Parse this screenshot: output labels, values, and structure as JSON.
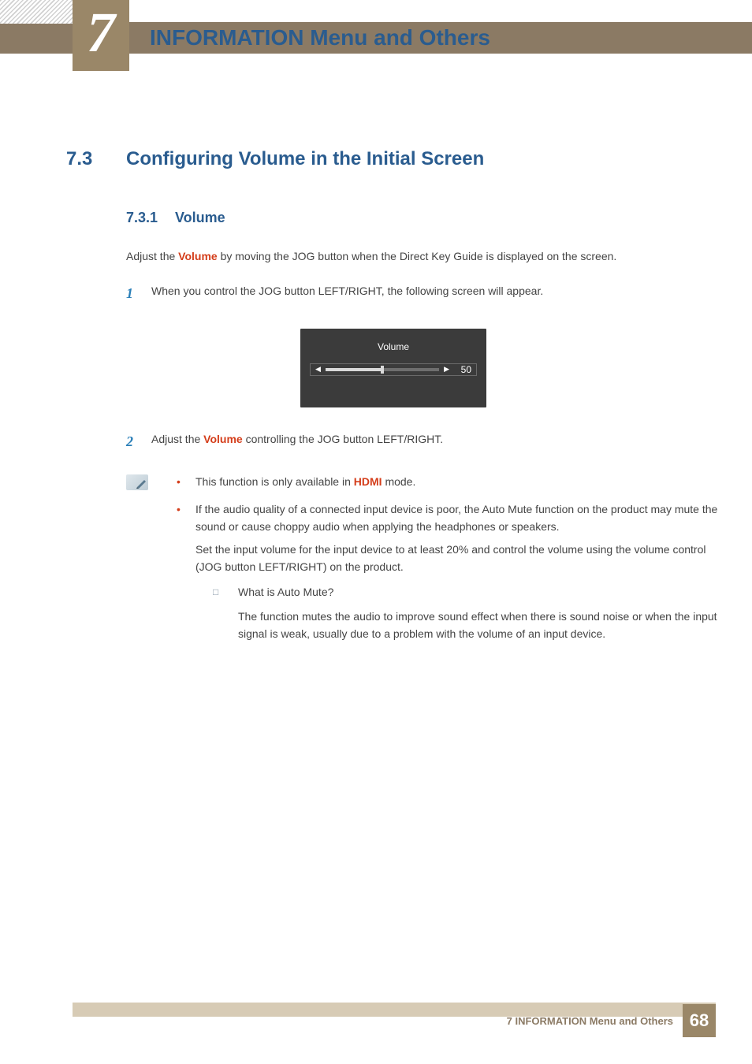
{
  "chapter": {
    "number": "7",
    "title": "INFORMATION Menu and Others"
  },
  "section": {
    "number": "7.3",
    "title": "Configuring Volume in the Initial Screen"
  },
  "subsection": {
    "number": "7.3.1",
    "title": "Volume"
  },
  "intro": {
    "prefix": "Adjust the ",
    "keyword": "Volume",
    "suffix": " by moving the JOG button when the Direct Key Guide is displayed on the screen."
  },
  "steps": [
    {
      "num": "1",
      "text": "When you control the JOG button LEFT/RIGHT, the following screen will appear."
    },
    {
      "num": "2",
      "prefix": "Adjust the ",
      "keyword": "Volume",
      "suffix": " controlling the JOG button LEFT/RIGHT."
    }
  ],
  "osd": {
    "title": "Volume",
    "value": "50"
  },
  "notes": [
    {
      "prefix": "This function is only available in ",
      "keyword": "HDMI",
      "suffix": " mode."
    },
    {
      "text": "If the audio quality of a connected input device is poor, the Auto Mute function on the product may mute the sound or cause choppy audio when applying the headphones or speakers.",
      "text2": "Set the input volume for the input device to at least 20% and control the volume using the volume control (JOG button LEFT/RIGHT) on the product.",
      "sub_q": "What is Auto Mute?",
      "sub_a": "The function mutes the audio to improve sound effect when there is sound noise or when the input signal is weak, usually due to a problem with the volume of an input device."
    }
  ],
  "footer": {
    "text": "7 INFORMATION Menu and Others",
    "page": "68"
  }
}
